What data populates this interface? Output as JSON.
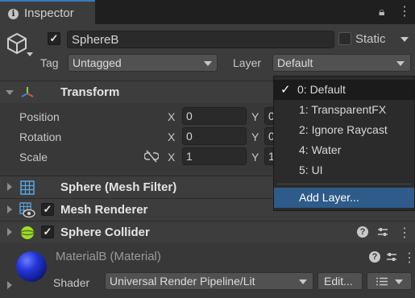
{
  "tab": {
    "label": "Inspector"
  },
  "object": {
    "name": "SphereB",
    "active": true,
    "static_label": "Static",
    "static_checked": false,
    "tag_label": "Tag",
    "tag_value": "Untagged",
    "layer_label": "Layer",
    "layer_value": "Default"
  },
  "transform": {
    "title": "Transform",
    "rows": [
      {
        "label": "Position",
        "x": "0",
        "y": "0"
      },
      {
        "label": "Rotation",
        "x": "0",
        "y": "0"
      },
      {
        "label": "Scale",
        "x": "1",
        "y": "1"
      }
    ],
    "axis_x": "X",
    "axis_y": "Y"
  },
  "components": [
    {
      "title": "Sphere (Mesh Filter)"
    },
    {
      "title": "Mesh Renderer",
      "enabled": true
    },
    {
      "title": "Sphere Collider",
      "enabled": true
    }
  ],
  "material": {
    "title": "MaterialB (Material)",
    "shader_label": "Shader",
    "shader_value": "Universal Render Pipeline/Lit",
    "edit_button": "Edit..."
  },
  "layer_menu": {
    "items": [
      {
        "label": "0: Default",
        "selected": true
      },
      {
        "label": "1: TransparentFX"
      },
      {
        "label": "2: Ignore Raycast"
      },
      {
        "label": "4: Water"
      },
      {
        "label": "5: UI"
      }
    ],
    "add_label": "Add Layer...",
    "check_glyph": "✓"
  },
  "colors": {
    "accent_tab": "#3a79bb",
    "menu_highlight": "#2e5b8a",
    "collider_green": "#9fdc2e",
    "material_blue": "#2436d8"
  }
}
